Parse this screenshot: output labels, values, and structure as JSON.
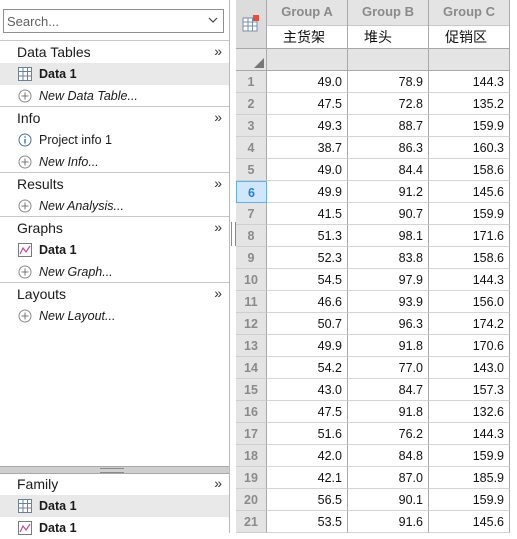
{
  "navigator": {
    "search_placeholder": "Search...",
    "sections": [
      {
        "title": "Data Tables",
        "items": [
          {
            "label": "Data 1",
            "kind": "table",
            "style": "bold",
            "selected": true
          },
          {
            "label": "New Data Table...",
            "kind": "add",
            "style": "italic"
          }
        ]
      },
      {
        "title": "Info",
        "items": [
          {
            "label": "Project info 1",
            "kind": "info",
            "style": "normal"
          },
          {
            "label": "New Info...",
            "kind": "add",
            "style": "italic"
          }
        ]
      },
      {
        "title": "Results",
        "items": [
          {
            "label": "New Analysis...",
            "kind": "add",
            "style": "italic"
          }
        ]
      },
      {
        "title": "Graphs",
        "items": [
          {
            "label": "Data 1",
            "kind": "graph",
            "style": "bold"
          },
          {
            "label": "New Graph...",
            "kind": "add",
            "style": "italic"
          }
        ]
      },
      {
        "title": "Layouts",
        "items": [
          {
            "label": "New Layout...",
            "kind": "add",
            "style": "italic"
          }
        ]
      }
    ],
    "more_glyph": "»"
  },
  "family": {
    "title": "Family",
    "items": [
      {
        "label": "Data 1",
        "kind": "table",
        "selected": true
      },
      {
        "label": "Data 1",
        "kind": "graph"
      }
    ]
  },
  "table": {
    "columns": [
      {
        "group": "Group A",
        "title": "主货架"
      },
      {
        "group": "Group B",
        "title": "堆头"
      },
      {
        "group": "Group C",
        "title": "促销区"
      }
    ],
    "active_row": 6,
    "rows": [
      {
        "n": "1",
        "a": "49.0",
        "b": "78.9",
        "c": "144.3"
      },
      {
        "n": "2",
        "a": "47.5",
        "b": "72.8",
        "c": "135.2"
      },
      {
        "n": "3",
        "a": "49.3",
        "b": "88.7",
        "c": "159.9"
      },
      {
        "n": "4",
        "a": "38.7",
        "b": "86.3",
        "c": "160.3"
      },
      {
        "n": "5",
        "a": "49.0",
        "b": "84.4",
        "c": "158.6"
      },
      {
        "n": "6",
        "a": "49.9",
        "b": "91.2",
        "c": "145.6"
      },
      {
        "n": "7",
        "a": "41.5",
        "b": "90.7",
        "c": "159.9"
      },
      {
        "n": "8",
        "a": "51.3",
        "b": "98.1",
        "c": "171.6"
      },
      {
        "n": "9",
        "a": "52.3",
        "b": "83.8",
        "c": "158.6"
      },
      {
        "n": "10",
        "a": "54.5",
        "b": "97.9",
        "c": "144.3"
      },
      {
        "n": "11",
        "a": "46.6",
        "b": "93.9",
        "c": "156.0"
      },
      {
        "n": "12",
        "a": "50.7",
        "b": "96.3",
        "c": "174.2"
      },
      {
        "n": "13",
        "a": "49.9",
        "b": "91.8",
        "c": "170.6"
      },
      {
        "n": "14",
        "a": "54.2",
        "b": "77.0",
        "c": "143.0"
      },
      {
        "n": "15",
        "a": "43.0",
        "b": "84.7",
        "c": "157.3"
      },
      {
        "n": "16",
        "a": "47.5",
        "b": "91.8",
        "c": "132.6"
      },
      {
        "n": "17",
        "a": "51.6",
        "b": "76.2",
        "c": "144.3"
      },
      {
        "n": "18",
        "a": "42.0",
        "b": "84.8",
        "c": "159.9"
      },
      {
        "n": "19",
        "a": "42.1",
        "b": "87.0",
        "c": "185.9"
      },
      {
        "n": "20",
        "a": "56.5",
        "b": "90.1",
        "c": "159.9"
      },
      {
        "n": "21",
        "a": "53.5",
        "b": "91.6",
        "c": "145.6"
      }
    ]
  }
}
